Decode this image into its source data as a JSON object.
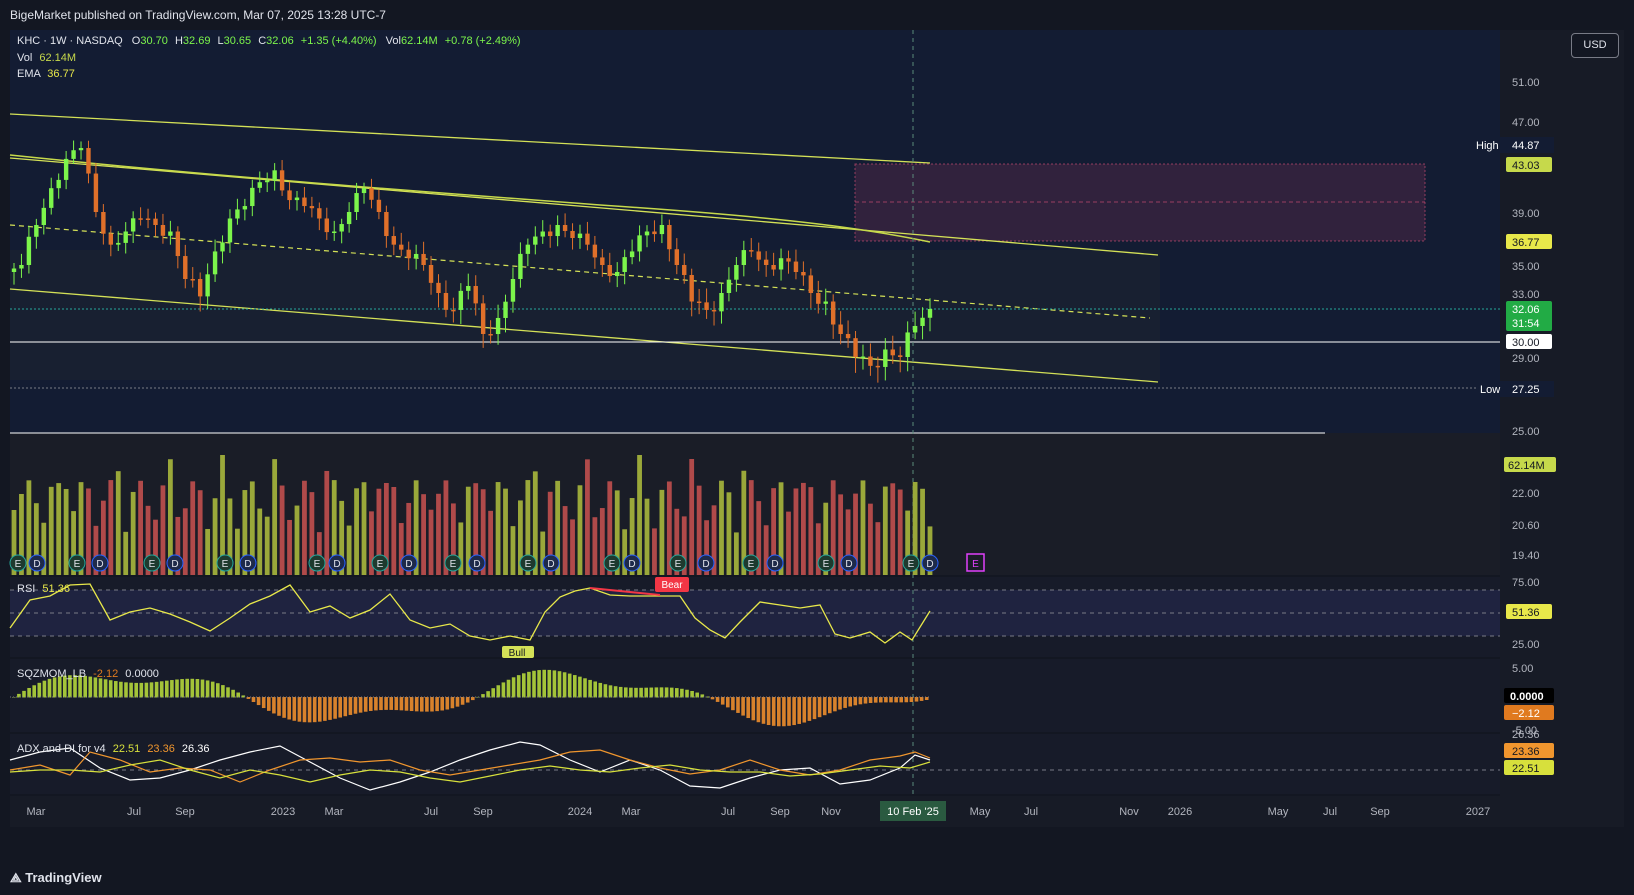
{
  "header": {
    "published": "BigeMarket published on TradingView.com, Mar 07, 2025 13:28 UTC-7"
  },
  "footer": {
    "brand": "TradingView"
  },
  "currency_button": "USD",
  "legend": {
    "symbol": "KHC · 1W · NASDAQ",
    "o_label": "O",
    "o_value": "30.70",
    "h_label": "H",
    "h_value": "32.69",
    "l_label": "L",
    "l_value": "30.65",
    "c_label": "C",
    "c_value": "32.06",
    "change": "+1.35 (+4.40%)",
    "vol_label": "Vol",
    "vol_value": "62.14M",
    "vol_change": "+0.78 (+2.49%)",
    "vol_row_label": "Vol",
    "vol_row_value": "62.14M",
    "ema_label": "EMA",
    "ema_value": "36.77"
  },
  "price_axis": {
    "ticks": [
      "51.00",
      "47.00",
      "39.00",
      "35.00",
      "33.00",
      "29.00",
      "25.00",
      "22.00",
      "20.60",
      "19.40"
    ],
    "high_label": "High",
    "high_value": "44.87",
    "low_label": "Low",
    "low_value": "27.25",
    "tag_43": "43.03",
    "tag_ema": "36.77",
    "tag_close": "32.06",
    "tag_countdown": "31:54",
    "tag_30": "30.00",
    "tag_vol": "62.14M"
  },
  "time_axis": {
    "labels": [
      "Mar",
      "Jul",
      "Sep",
      "2023",
      "Mar",
      "Jul",
      "Sep",
      "2024",
      "Mar",
      "Jul",
      "Sep",
      "Nov",
      "2025",
      "May",
      "Jul",
      "Nov",
      "2026",
      "May",
      "Jul",
      "Sep",
      "2027"
    ],
    "cursor_label": "10 Feb '25"
  },
  "rsi": {
    "label": "RSI",
    "value": "51.36",
    "ticks": [
      "75.00",
      "25.00"
    ],
    "tag": "51.36",
    "bear_label": "Bear",
    "bull_label": "Bull"
  },
  "sqz": {
    "label": "SQZMOM_LB",
    "value1": "-2.12",
    "value2": "0.0000",
    "ticks": [
      "5.00",
      "-5.00"
    ],
    "tag_zero": "0.0000",
    "tag_val": "−2.12"
  },
  "adx": {
    "label": "ADX and DI for v4",
    "v1": "22.51",
    "v2": "23.36",
    "v3": "26.36",
    "tick_top": "26.36",
    "tag_orange": "23.36",
    "tag_yellow": "22.51"
  },
  "event_markers": {
    "earnings": "E",
    "dividend": "D"
  },
  "colors": {
    "background": "#131722",
    "up": "#26a69a",
    "up_candle": "#7cf54b",
    "down_candle": "#e0702a",
    "channel": "#d4e157",
    "ema": "#c6d94b",
    "zone": "#e0507a",
    "rsi_line": "#e8e84a",
    "vol_up": "#9aa83a",
    "vol_down": "#b04a4a",
    "adx_white": "#ffffff",
    "adx_orange": "#f0962e",
    "adx_yellow": "#d7e03c",
    "sqz_green": "#a4c439",
    "sqz_orange": "#d8822c"
  },
  "chart_data": {
    "type": "candlestick",
    "symbol": "KHC",
    "interval": "1W",
    "exchange": "NASDAQ",
    "ylim": [
      19.4,
      52.0
    ],
    "last": {
      "open": 30.7,
      "high": 32.69,
      "low": 30.65,
      "close": 32.06,
      "volume": "62.14M"
    },
    "levels": {
      "high": 44.87,
      "low": 27.25,
      "ema": 36.77,
      "zone_top": 43.03,
      "zone_bottom": 36.77,
      "horizontal": 30.0
    },
    "closes_approx": [
      35.0,
      38.0,
      41.0,
      43.5,
      44.5,
      39.0,
      36.5,
      37.5,
      38.5,
      38.0,
      37.5,
      34.0,
      32.8,
      36.0,
      38.5,
      39.5,
      41.5,
      42.5,
      40.0,
      39.5,
      38.5,
      37.5,
      39.0,
      41.0,
      39.0,
      36.5,
      35.5,
      35.0,
      33.0,
      32.0,
      33.5,
      30.5,
      31.5,
      34.0,
      36.5,
      37.5,
      38.0,
      37.0,
      36.5,
      35.0,
      34.5,
      36.0,
      37.5,
      38.0,
      35.0,
      32.5,
      32.0,
      33.0,
      35.0,
      36.0,
      35.0,
      35.5,
      34.5,
      33.0,
      32.5,
      30.5,
      29.0,
      28.5,
      29.5,
      29.0,
      31.0,
      32.06
    ],
    "series": [
      {
        "name": "RSI",
        "last": 51.36,
        "range": [
          0,
          100
        ]
      },
      {
        "name": "SQZMOM_LB",
        "last": -2.12
      },
      {
        "name": "ADX",
        "values_last": [
          22.51,
          23.36,
          26.36
        ]
      }
    ]
  }
}
